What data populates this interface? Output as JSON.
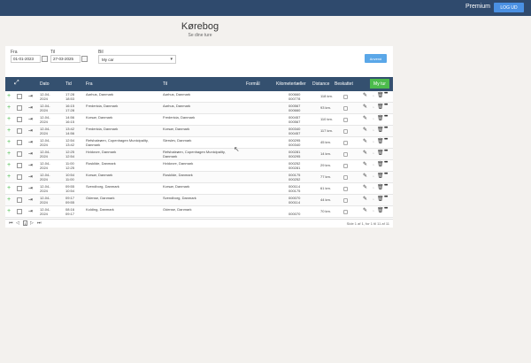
{
  "header": {
    "premium_label": "Premium",
    "logout_label": "LOG UD"
  },
  "page": {
    "title": "Kørebog",
    "subtitle": "Se dine ture"
  },
  "filters": {
    "from_label": "Fra",
    "from_value": "01-01-2023",
    "to_label": "Til",
    "to_value": "27-03-2025",
    "car_label": "Bil",
    "car_value": "My car",
    "apply_label": "Anvend"
  },
  "table": {
    "headers": {
      "date": "Dato",
      "time": "Tid",
      "from": "Fra",
      "to": "Til",
      "purpose": "Formål",
      "odometer": "Kilometertæller",
      "distance": "Distance",
      "reimbursed": "Beskattet"
    },
    "my_trip_label": "My tur",
    "rows": [
      {
        "date": [
          "12-04-",
          "2024"
        ],
        "time": [
          "17:28",
          "18:53"
        ],
        "from": [
          "Aarhus, Danmark"
        ],
        "to": [
          "Aarhus, Danmark"
        ],
        "odo": [
          "000660",
          "000778"
        ],
        "dist": "118 km."
      },
      {
        "date": [
          "12-04-",
          "2024"
        ],
        "time": [
          "16:15",
          "17:28"
        ],
        "from": [
          "Fredericia, Danmark"
        ],
        "to": [
          "Aarhus, Danmark"
        ],
        "odo": [
          "000567",
          "000660"
        ],
        "dist": "93 km."
      },
      {
        "date": [
          "12-04-",
          "2024"
        ],
        "time": [
          "14:56",
          "16:15"
        ],
        "from": [
          "Korsør, Danmark"
        ],
        "to": [
          "Fredericia, Danmark"
        ],
        "odo": [
          "000457",
          "000567"
        ],
        "dist": "110 km."
      },
      {
        "date": [
          "12-04-",
          "2024"
        ],
        "time": [
          "13:42",
          "14:56"
        ],
        "from": [
          "Fredericia, Danmark"
        ],
        "to": [
          "Korsør, Danmark"
        ],
        "odo": [
          "000340",
          "000457"
        ],
        "dist": "117 km."
      },
      {
        "date": [
          "12-04-",
          "2024"
        ],
        "time": [
          "12:54",
          "13:42"
        ],
        "from": [
          "Refshaleøen, Copenhagen Municipality,",
          "Danmark"
        ],
        "to": [
          "Slerslev, Danmark"
        ],
        "odo": [
          "000295",
          "000340"
        ],
        "dist": "45 km."
      },
      {
        "date": [
          "12-04-",
          "2024"
        ],
        "time": [
          "12:25",
          "12:54"
        ],
        "from": [
          "Hvidovre, Danmark"
        ],
        "to": [
          "Refshaleøen, Copenhagen Municipality,",
          "Danmark"
        ],
        "odo": [
          "000281",
          "000295"
        ],
        "dist": "14 km."
      },
      {
        "date": [
          "12-04-",
          "2024"
        ],
        "time": [
          "11:00",
          "12:25"
        ],
        "from": [
          "Roskilde, Danmark"
        ],
        "to": [
          "Hvidovre, Danmark"
        ],
        "odo": [
          "000252",
          "000281"
        ],
        "dist": "29 km."
      },
      {
        "date": [
          "12-04-",
          "2024"
        ],
        "time": [
          "10:54",
          "11:00"
        ],
        "from": [
          "Korsør, Danmark"
        ],
        "to": [
          "Roskilde, Danmark"
        ],
        "odo": [
          "000175",
          "000252"
        ],
        "dist": "77 km."
      },
      {
        "date": [
          "12-04-",
          "2024"
        ],
        "time": [
          "09:55",
          "10:54"
        ],
        "from": [
          "Svendborg, Danmark"
        ],
        "to": [
          "Korsør, Danmark"
        ],
        "odo": [
          "000114",
          "000175"
        ],
        "dist": "61 km."
      },
      {
        "date": [
          "12-04-",
          "2024"
        ],
        "time": [
          "09:17",
          "09:55"
        ],
        "from": [
          "Odense, Danmark"
        ],
        "to": [
          "Svendborg, Danmark"
        ],
        "odo": [
          "000070",
          "000114"
        ],
        "dist": "44 km."
      },
      {
        "date": [
          "12-04-",
          "2024"
        ],
        "time": [
          "08:16",
          "09:17"
        ],
        "from": [
          "Kolding, Danmark"
        ],
        "to": [
          "Odense, Danmark"
        ],
        "odo": [
          "",
          "000070"
        ],
        "dist": "70 km."
      }
    ]
  },
  "pagination": {
    "current_page": "1",
    "info": "Side 1 af 1, for 1 til 11 af 11"
  },
  "icons": {
    "expand": "expand-icon",
    "edit": "pencil-icon",
    "archive": "archive-icon",
    "delete": "trash-icon",
    "more": "more-icon",
    "sort": "sort-icon"
  }
}
